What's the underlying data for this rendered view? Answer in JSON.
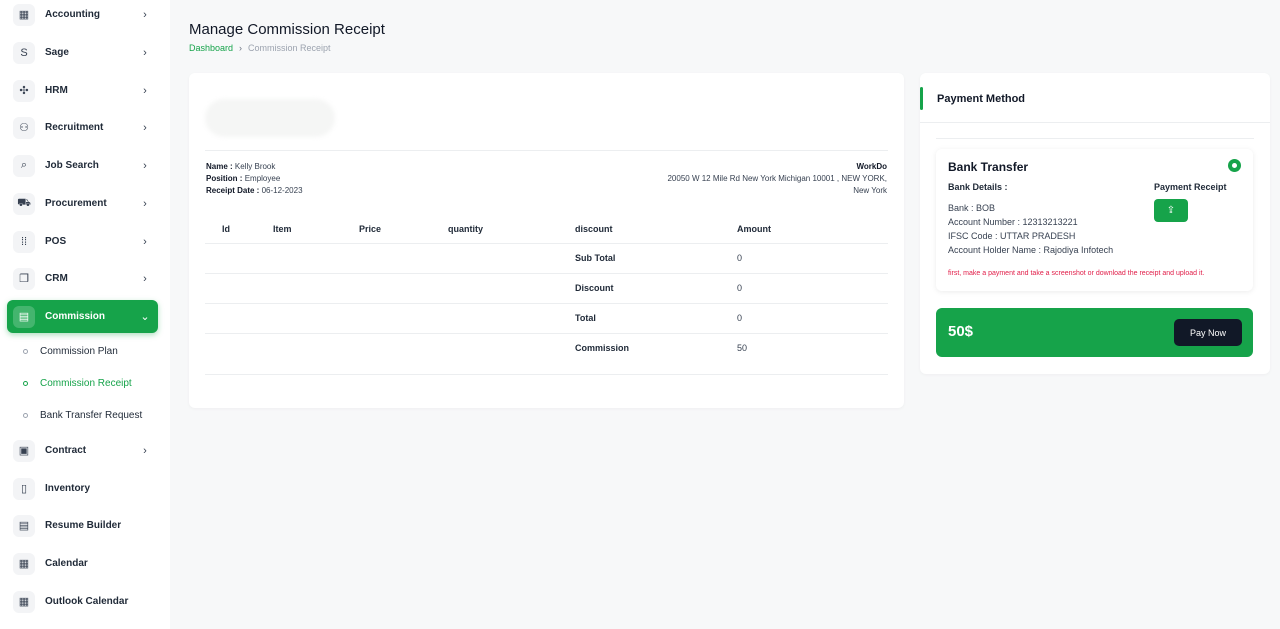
{
  "sidebar": {
    "items": [
      {
        "label": "Accounting",
        "icon": "grid-icon",
        "glyph": "▦",
        "chevron": "›"
      },
      {
        "label": "Sage",
        "icon": "sage-s-icon",
        "glyph": "S",
        "chevron": "›"
      },
      {
        "label": "HRM",
        "icon": "hrm-icon",
        "glyph": "✣",
        "chevron": "›"
      },
      {
        "label": "Recruitment",
        "icon": "user-plus-icon",
        "glyph": "⚇",
        "chevron": "›"
      },
      {
        "label": "Job Search",
        "icon": "file-search-icon",
        "glyph": "⌕",
        "chevron": "›"
      },
      {
        "label": "Procurement",
        "icon": "cart-icon",
        "glyph": "⛟",
        "chevron": "›"
      },
      {
        "label": "POS",
        "icon": "dots-grid-icon",
        "glyph": "⁞⁞",
        "chevron": "›"
      },
      {
        "label": "CRM",
        "icon": "layers-icon",
        "glyph": "❐",
        "chevron": "›"
      },
      {
        "label": "Commission",
        "icon": "receipt-icon",
        "glyph": "▤",
        "chevron": "⌄"
      },
      {
        "label": "Contract",
        "icon": "contract-icon",
        "glyph": "▣",
        "chevron": "›"
      },
      {
        "label": "Inventory",
        "icon": "file-icon",
        "glyph": "▯",
        "chevron": ""
      },
      {
        "label": "Resume Builder",
        "icon": "resume-icon",
        "glyph": "▤",
        "chevron": ""
      },
      {
        "label": "Calendar",
        "icon": "calendar-icon",
        "glyph": "▦",
        "chevron": ""
      },
      {
        "label": "Outlook Calendar",
        "icon": "calendar-icon",
        "glyph": "▦",
        "chevron": ""
      }
    ],
    "sub_items": [
      "Commission Plan",
      "Commission Receipt",
      "Bank Transfer Request"
    ]
  },
  "header": {
    "title": "Manage Commission Receipt",
    "breadcrumb_home": "Dashboard",
    "breadcrumb_sep": "›",
    "breadcrumb_current": "Commission Receipt"
  },
  "receipt": {
    "name_label": "Name :",
    "name": "Kelly Brook",
    "position_label": "Position :",
    "position": "Employee",
    "date_label": "Receipt Date :",
    "date": "06-12-2023",
    "company": "WorkDo",
    "address_line1": "20050 W 12 Mile Rd New York Michigan 10001 , NEW YORK,",
    "address_line2": "New York",
    "columns": [
      "Id",
      "Item",
      "Price",
      "quantity",
      "discount",
      "Amount"
    ],
    "summary": [
      {
        "label": "Sub Total",
        "value": "0"
      },
      {
        "label": "Discount",
        "value": "0"
      },
      {
        "label": "Total",
        "value": "0"
      },
      {
        "label": "Commission",
        "value": "50"
      }
    ]
  },
  "payment": {
    "title": "Payment Method",
    "method": "Bank Transfer",
    "bank_details_label": "Bank Details :",
    "bank": "Bank : BOB",
    "account_number": "Account Number : 12313213221",
    "ifsc": "IFSC Code : UTTAR PRADESH",
    "holder": "Account Holder Name : Rajodiya Infotech",
    "receipt_label": "Payment Receipt",
    "upload_icon_glyph": "⇪",
    "note": "first, make a payment and take a screenshot or download the receipt and upload it.",
    "amount": "50$",
    "pay_button": "Pay Now"
  },
  "colors": {
    "accent": "#16a34a",
    "dark": "#111827",
    "note": "#e11d48"
  }
}
